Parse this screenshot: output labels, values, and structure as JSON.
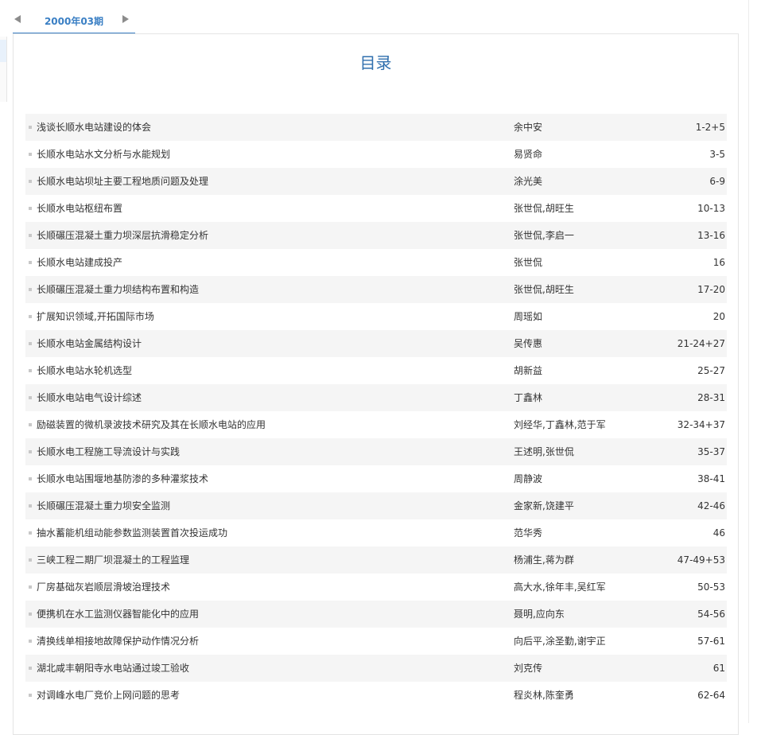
{
  "issue_nav": {
    "label": "2000年03期",
    "prev_icon": "triangle-left-icon",
    "next_icon": "triangle-right-icon",
    "accent_color": "#3a7fc4"
  },
  "toc": {
    "heading": "目录",
    "heading_color": "#2f6fae",
    "items": [
      {
        "title": "浅谈长顺水电站建设的体会",
        "authors": "余中安",
        "pages": "1-2+5"
      },
      {
        "title": "长顺水电站水文分析与水能规划",
        "authors": "易贤命",
        "pages": "3-5"
      },
      {
        "title": "长顺水电站坝址主要工程地质问题及处理",
        "authors": "涂光美",
        "pages": "6-9"
      },
      {
        "title": "长顺水电站枢纽布置",
        "authors": "张世侃,胡旺生",
        "pages": "10-13"
      },
      {
        "title": "长顺碾压混凝土重力坝深层抗滑稳定分析",
        "authors": "张世侃,李启一",
        "pages": "13-16"
      },
      {
        "title": "长顺水电站建成投产",
        "authors": "张世侃",
        "pages": "16"
      },
      {
        "title": "长顺碾压混凝土重力坝结构布置和构造",
        "authors": "张世侃,胡旺生",
        "pages": "17-20"
      },
      {
        "title": "扩展知识领域,开拓国际市场",
        "authors": "周瑶如",
        "pages": "20"
      },
      {
        "title": "长顺水电站金属结构设计",
        "authors": "吴传惠",
        "pages": "21-24+27"
      },
      {
        "title": "长顺水电站水轮机选型",
        "authors": "胡新益",
        "pages": "25-27"
      },
      {
        "title": "长顺水电站电气设计综述",
        "authors": "丁鑫林",
        "pages": "28-31"
      },
      {
        "title": "励磁装置的微机录波技术研究及其在长顺水电站的应用",
        "authors": "刘经华,丁鑫林,范于军",
        "pages": "32-34+37"
      },
      {
        "title": "长顺水电工程施工导流设计与实践",
        "authors": "王述明,张世侃",
        "pages": "35-37"
      },
      {
        "title": "长顺水电站围堰地基防渗的多种灌浆技术",
        "authors": "周静波",
        "pages": "38-41"
      },
      {
        "title": "长顺碾压混凝土重力坝安全监测",
        "authors": "金家新,饶建平",
        "pages": "42-46"
      },
      {
        "title": "抽水蓄能机组动能参数监测装置首次投运成功",
        "authors": "范华秀",
        "pages": "46"
      },
      {
        "title": "三峡工程二期厂坝混凝土的工程监理",
        "authors": "杨浦生,蒋为群",
        "pages": "47-49+53"
      },
      {
        "title": "厂房基础灰岩顺层滑坡治理技术",
        "authors": "高大水,徐年丰,吴红军",
        "pages": "50-53"
      },
      {
        "title": "便携机在水工监测仪器智能化中的应用",
        "authors": "聂明,应向东",
        "pages": "54-56"
      },
      {
        "title": "清换线单相接地故障保护动作情况分析",
        "authors": "向后平,涂圣勤,谢宇正",
        "pages": "57-61"
      },
      {
        "title": "湖北咸丰朝阳寺水电站通过竣工验收",
        "authors": "刘克传",
        "pages": "61"
      },
      {
        "title": "对调峰水电厂竞价上网问题的思考",
        "authors": "程炎林,陈奎勇",
        "pages": "62-64"
      }
    ]
  }
}
